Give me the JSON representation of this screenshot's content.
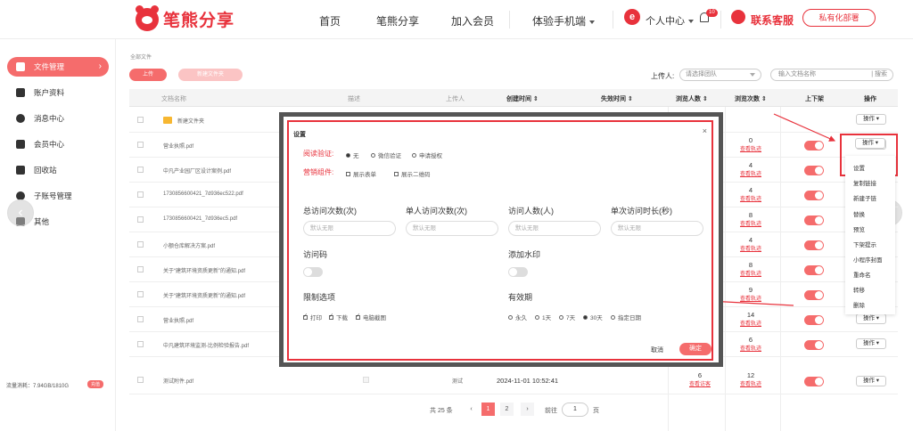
{
  "header": {
    "logo_text": "笔熊分享",
    "nav": [
      "首页",
      "笔熊分享",
      "加入会员",
      "体验手机端"
    ],
    "avatar_letter": "e",
    "user_center": "个人中心",
    "notification_count": "10",
    "customer_service": "联系客服",
    "private_deploy": "私有化部署"
  },
  "sidebar": {
    "items": [
      "文件管理",
      "账户资料",
      "消息中心",
      "会员中心",
      "回收站",
      "子账号管理",
      "其他"
    ],
    "traffic": "流量消耗：7.94GB/1810G",
    "traffic_badge": "充值"
  },
  "main": {
    "breadcrumb": "全部文件",
    "upload_btn": "上传",
    "new_folder_btn": "新建文件夹",
    "uploader_label": "上传人:",
    "team_placeholder": "请选择团队",
    "search_placeholder": "输入文档名称",
    "search_btn": "搜索",
    "columns": [
      "文档名称",
      "描述",
      "上传人",
      "创建时间",
      "失效时间",
      "浏览人数",
      "浏览次数",
      "上下架",
      "操作"
    ],
    "rows": [
      {
        "name": "新建文件夹",
        "op": "操作"
      },
      {
        "name": "营业执照.pdf",
        "views": "0",
        "link": "查看轨迹",
        "op": "操作"
      },
      {
        "name": "中凡产业园厂区设计案例.pdf",
        "views": "4",
        "link": "查看轨迹",
        "op": "操作"
      },
      {
        "name": "1730856600421_7d936ec522.pdf",
        "views": "4",
        "link": "查看轨迹",
        "op": "操作"
      },
      {
        "name": "1730856600421_7d936ec5.pdf",
        "views": "8",
        "link": "查看轨迹",
        "op": "操作"
      },
      {
        "name": "小额仓库解决方案.pdf",
        "views": "4",
        "link": "查看轨迹",
        "op": "操作"
      },
      {
        "name": "关于“建筑环境资质更新”的通知.pdf",
        "views": "8",
        "link": "查看轨迹",
        "op": "操作"
      },
      {
        "name": "关于“建筑环境资质更新”的通知.pdf",
        "views": "9",
        "link": "查看轨迹",
        "op": "操作"
      },
      {
        "name": "营业执照.pdf",
        "views": "14",
        "link": "查看轨迹",
        "op": "操作"
      },
      {
        "name": "中凡建筑环境监测-比例检验报告.pdf",
        "views": "6",
        "link": "查看轨迹",
        "op": "操作"
      },
      {
        "name": "测试附件.pdf",
        "uploader": "测试",
        "created": "2024-11-01 10:52:41",
        "people": "6",
        "people_link": "查看访客",
        "views": "12",
        "link": "查看轨迹",
        "op": "操作"
      }
    ],
    "dropdown": [
      "设置",
      "复制链接",
      "新建子链",
      "替换",
      "预览",
      "下架提示",
      "小程序封面",
      "重命名",
      "转移",
      "删除"
    ]
  },
  "pagination": {
    "total": "共 25 条",
    "pages": [
      "1",
      "2"
    ],
    "goto": "前往",
    "page_input": "1",
    "page_suffix": "页"
  },
  "modal": {
    "title": "设置",
    "read_verify_label": "阅读验证:",
    "read_verify_options": [
      "无",
      "微信验证",
      "申请授权"
    ],
    "marketing_label": "营销组件:",
    "marketing_options": [
      "展示表单",
      "展示二维码"
    ],
    "fields": [
      "总访问次数(次)",
      "单人访问次数(次)",
      "访问人数(人)",
      "单次访问时长(秒)"
    ],
    "field_placeholder": "默认无限",
    "access_code": "访问码",
    "watermark": "添加水印",
    "limit_label": "限制选项",
    "limit_options": [
      "打印",
      "下载",
      "电脑截图"
    ],
    "validity_label": "有效期",
    "validity_options": [
      "永久",
      "1天",
      "7天",
      "30天",
      "指定日期"
    ],
    "cancel": "取消",
    "ok": "确定"
  },
  "colors": {
    "accent": "#f56c6c",
    "brand": "#e8323c"
  }
}
